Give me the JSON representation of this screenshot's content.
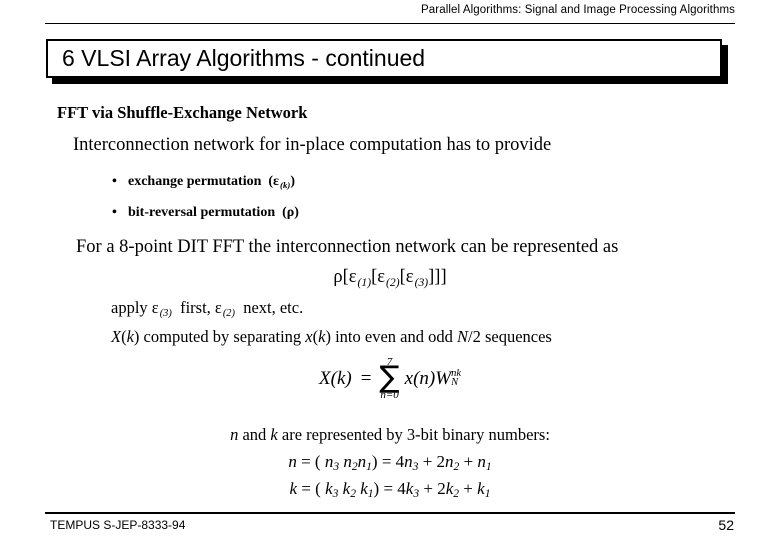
{
  "header": {
    "title": "Parallel Algorithms:  Signal and Image Processing Algorithms"
  },
  "slide": {
    "title": "6 VLSI  Array  Algorithms - continued",
    "heading": "FFT via Shuffle-Exchange Network",
    "intro": "Interconnection network for in-place computation has to provide",
    "bullets": [
      {
        "marker": "•",
        "text": "exchange permutation",
        "symbol": "(ε",
        "symbol_sub": "(k)",
        "symbol_close": ")"
      },
      {
        "marker": "•",
        "text": "bit-reversal permutation",
        "symbol": "(ρ)",
        "symbol_sub": "",
        "symbol_close": ""
      }
    ],
    "for_line": "For a 8-point DIT FFT the interconnection network can be represented as",
    "rho_formula": {
      "open": "ρ[ε",
      "sub1": "(1)",
      "mid1": "[ε",
      "sub2": "(2)",
      "mid2": "[ε",
      "sub3": "(3)",
      "close": "]]]"
    },
    "apply_line": {
      "prefix": "apply ε",
      "sub1": "(3)",
      "mid": "first, ε",
      "sub2": "(2)",
      "suffix": "next, etc."
    },
    "xk_line": {
      "p1": "X",
      "p2": "(",
      "p3": "k",
      "p4": ") computed by separating ",
      "p5": "x",
      "p6": "(",
      "p7": "k",
      "p8": ") into even and odd ",
      "p9": "N",
      "p10": "/2 sequences"
    },
    "equation": {
      "lhs_func": "X",
      "lhs_open": "(",
      "lhs_var": "k",
      "lhs_close": ")",
      "equals": "=",
      "sum_upper": "7",
      "sum_glyph": "∑",
      "sum_lower": "n=0",
      "term_func": "x",
      "term_open": "(",
      "term_var": "n",
      "term_close": ")",
      "w_letter": "W",
      "w_sup": "nk",
      "w_sub": "N"
    },
    "nk_line": {
      "p1": "n",
      "p2": " and ",
      "p3": "k",
      "p4": " are represented by 3-bit binary numbers:"
    },
    "n_equation": {
      "var": "n",
      "eq1": " = ( ",
      "d3": "n",
      "d3s": "3",
      "sp": " ",
      "d2": "n",
      "d2s": "2",
      "d1": "n",
      "d1s": "1",
      "eq2": ") = 4",
      "t3": "n",
      "t3s": "3",
      "plus1": " + 2",
      "t2": "n",
      "t2s": "2",
      "plus2": " + ",
      "t1": "n",
      "t1s": "1"
    },
    "k_equation": {
      "var": "k",
      "eq1": " = ( ",
      "d3": "k",
      "d3s": "3",
      "sp": " ",
      "d2": "k",
      "d2s": "2",
      "d1": "k",
      "d1s": "1",
      "eq2": ") = 4",
      "t3": "k",
      "t3s": "3",
      "plus1": " + 2",
      "t2": "k",
      "t2s": "2",
      "plus2": " + ",
      "t1": "k",
      "t1s": "1"
    }
  },
  "footer": {
    "project": "TEMPUS S-JEP-8333-94",
    "page_number": "52"
  },
  "colors": {
    "text": "#000000",
    "background": "#ffffff"
  }
}
